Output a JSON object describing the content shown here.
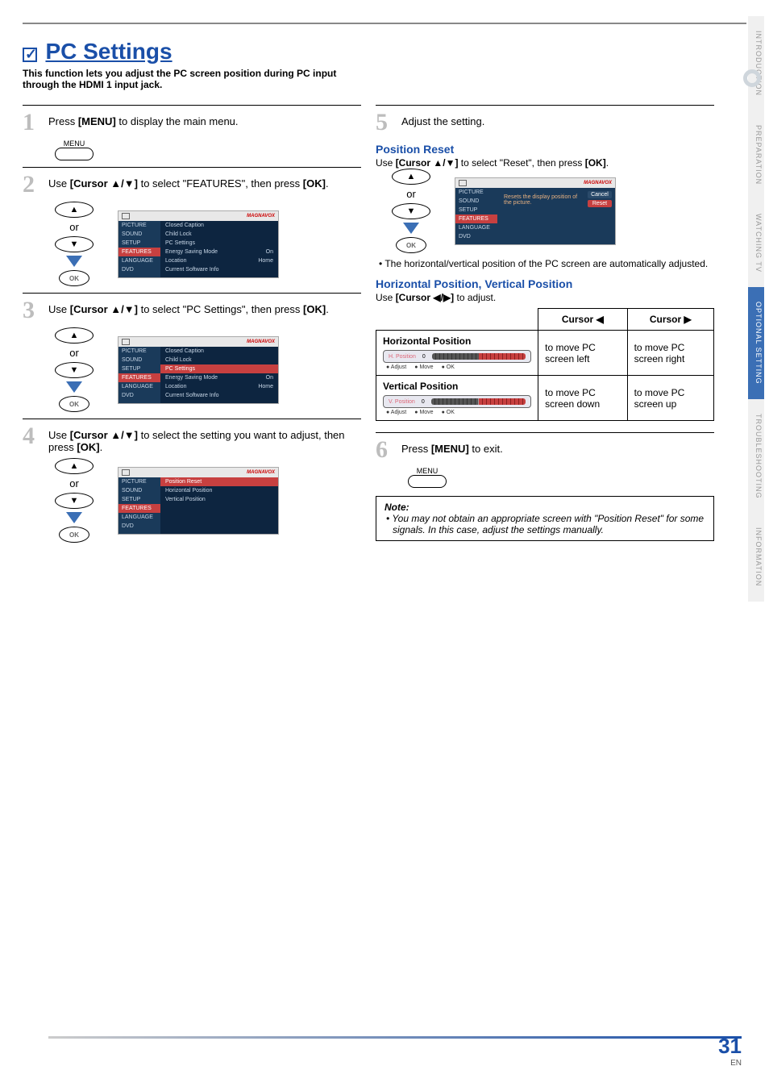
{
  "header": {
    "title": "PC Settings",
    "subtitle": "This function lets you adjust the PC screen position during PC input through the HDMI 1 input jack."
  },
  "steps": {
    "s1": {
      "num": "1",
      "text_a": "Press ",
      "text_b": "[MENU]",
      "text_c": " to display the main menu."
    },
    "s2": {
      "num": "2",
      "text_a": "Use ",
      "text_b": "[Cursor ▲/▼]",
      "text_c": " to select \"FEATURES\", then press ",
      "text_d": "[OK]",
      "text_e": "."
    },
    "s3": {
      "num": "3",
      "text_a": "Use ",
      "text_b": "[Cursor ▲/▼]",
      "text_c": " to select \"PC Settings\", then press ",
      "text_d": "[OK]",
      "text_e": "."
    },
    "s4": {
      "num": "4",
      "text_a": "Use ",
      "text_b": "[Cursor ▲/▼]",
      "text_c": " to select the setting you want to adjust, then press ",
      "text_d": "[OK]",
      "text_e": "."
    },
    "s5": {
      "num": "5",
      "text_a": "Adjust the setting."
    },
    "s6": {
      "num": "6",
      "text_a": "Press ",
      "text_b": "[MENU]",
      "text_c": " to exit."
    }
  },
  "menu_button_label": "MENU",
  "or_label": "or",
  "ok_label": "OK",
  "osd_brand": "MAGNAVOX",
  "osd_side": [
    "PICTURE",
    "SOUND",
    "SETUP",
    "FEATURES",
    "LANGUAGE",
    "DVD"
  ],
  "osd_features_items": [
    {
      "label": "Closed Caption",
      "val": ""
    },
    {
      "label": "Child Lock",
      "val": ""
    },
    {
      "label": "PC Settings",
      "val": ""
    },
    {
      "label": "Energy Saving Mode",
      "val": "On"
    },
    {
      "label": "Location",
      "val": "Home"
    },
    {
      "label": "Current Software Info",
      "val": ""
    }
  ],
  "osd_pcsettings_items": [
    {
      "label": "Position Reset",
      "val": ""
    },
    {
      "label": "Horizontal Position",
      "val": ""
    },
    {
      "label": "Vertical Position",
      "val": ""
    }
  ],
  "osd_reset": {
    "message": "Resets the display position of the picture.",
    "buttons": [
      "Cancel",
      "Reset"
    ]
  },
  "position_reset": {
    "heading": "Position Reset",
    "text_a": "Use ",
    "text_b": "[Cursor ▲/▼]",
    "text_c": " to select \"Reset\", then press ",
    "text_d": "[OK]",
    "text_e": ".",
    "bullet": "The horizontal/vertical position of the PC screen are automatically adjusted."
  },
  "hv_position": {
    "heading": "Horizontal Position, Vertical Position",
    "text_a": "Use ",
    "text_b": "[Cursor ◀/▶]",
    "text_c": " to adjust."
  },
  "table": {
    "col_left_prefix": "Cursor",
    "col_left_sym": "◀",
    "col_right_prefix": "Cursor",
    "col_right_sym": "▶",
    "rows": [
      {
        "title": "Horizontal Position",
        "panel_label": "H. Position",
        "panel_val": "0",
        "left": "to move PC screen left",
        "right": "to move PC screen right"
      },
      {
        "title": "Vertical Position",
        "panel_label": "V. Position",
        "panel_val": "0",
        "left": "to move PC screen down",
        "right": "to move PC screen up"
      }
    ],
    "hints": [
      "Adjust",
      "Move",
      "OK"
    ]
  },
  "note": {
    "title": "Note:",
    "body": "You may not obtain an appropriate screen with \"Position Reset\" for some signals. In this case, adjust the settings manually."
  },
  "tabs": [
    "INTRODUCTION",
    "PREPARATION",
    "WATCHING TV",
    "OPTIONAL SETTING",
    "TROUBLESHOOTING",
    "INFORMATION"
  ],
  "footer": {
    "page": "31",
    "lang": "EN"
  }
}
